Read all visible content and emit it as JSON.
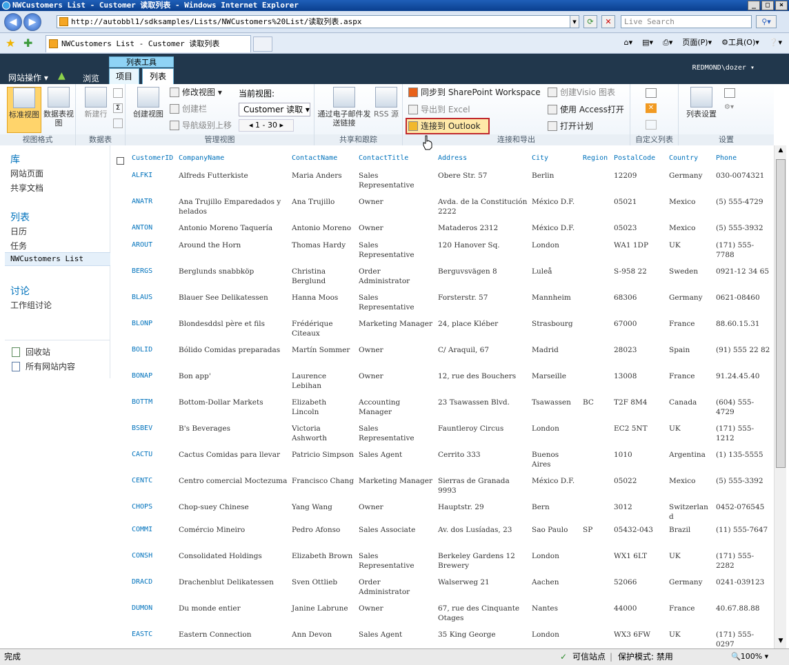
{
  "window": {
    "title": "NWCustomers List - Customer 读取列表 - Windows Internet Explorer"
  },
  "browser": {
    "url": "http://autobbl1/sdksamples/Lists/NWCustomers%20List/读取列表.aspx",
    "search_placeholder": "Live Search",
    "tab_title": "NWCustomers List - Customer 读取列表",
    "page_menu": "页面(P)",
    "tools_menu": "工具(O)"
  },
  "sp": {
    "site_actions": "网站操作",
    "browse": "浏览",
    "ctx_group": "列表工具",
    "tab_items": "项目",
    "tab_list": "列表",
    "user": "REDMOND\\dozer"
  },
  "ribbon": {
    "std_view": "标准视图",
    "datasheet_view": "数据表视图",
    "new_row": "新建行",
    "create_view": "创建视图",
    "modify_view": "修改视图",
    "create_column": "创建栏",
    "navigate_up": "导航级别上移",
    "current_view_label": "当前视图:",
    "current_view": "Customer 读取",
    "pager": "1 - 30",
    "email_link": "通过电子邮件发送链接",
    "rss": "RSS 源",
    "sync_workspace": "同步到 SharePoint Workspace",
    "export_excel": "导出到 Excel",
    "connect_outlook": "连接到 Outlook",
    "create_visio": "创建Visio 图表",
    "open_access": "使用 Access打开",
    "open_schedule": "打开计划",
    "list_settings": "列表设置",
    "groups": {
      "view_format": "视图格式",
      "datasheet": "数据表",
      "manage_views": "管理视图",
      "share_track": "共享和跟踪",
      "connect_export": "连接和导出",
      "custom_lists": "自定义列表",
      "settings": "设置"
    }
  },
  "nav": {
    "libraries": "库",
    "site_pages": "网站页面",
    "shared_docs": "共享文档",
    "lists": "列表",
    "calendar": "日历",
    "tasks": "任务",
    "nw_list": "NWCustomers List",
    "discussions": "讨论",
    "team_discussion": "工作组讨论",
    "recycle_bin": "回收站",
    "all_content": "所有网站内容"
  },
  "table": {
    "columns": [
      "CustomerID",
      "CompanyName",
      "ContactName",
      "ContactTitle",
      "Address",
      "City",
      "Region",
      "PostalCode",
      "Country",
      "Phone"
    ],
    "rows": [
      [
        "ALFKI",
        "Alfreds Futterkiste",
        "Maria Anders",
        "Sales Representative",
        "Obere Str. 57",
        "Berlin",
        "",
        "12209",
        "Germany",
        "030-0074321"
      ],
      [
        "ANATR",
        "Ana Trujillo Emparedados y helados",
        "Ana Trujillo",
        "Owner",
        "Avda. de la Constitución 2222",
        "México D.F.",
        "",
        "05021",
        "Mexico",
        "(5) 555-4729"
      ],
      [
        "ANTON",
        "Antonio Moreno Taquería",
        "Antonio Moreno",
        "Owner",
        "Mataderos 2312",
        "México D.F.",
        "",
        "05023",
        "Mexico",
        "(5) 555-3932"
      ],
      [
        "AROUT",
        "Around the Horn",
        "Thomas Hardy",
        "Sales Representative",
        "120 Hanover Sq.",
        "London",
        "",
        "WA1 1DP",
        "UK",
        "(171) 555-7788"
      ],
      [
        "BERGS",
        "Berglunds snabbköp",
        "Christina Berglund",
        "Order Administrator",
        "Berguvsvägen 8",
        "Luleå",
        "",
        "S-958 22",
        "Sweden",
        "0921-12 34 65"
      ],
      [
        "BLAUS",
        "Blauer See Delikatessen",
        "Hanna Moos",
        "Sales Representative",
        "Forsterstr. 57",
        "Mannheim",
        "",
        "68306",
        "Germany",
        "0621-08460"
      ],
      [
        "BLONP",
        "Blondesddsl père et fils",
        "Frédérique Citeaux",
        "Marketing Manager",
        "24, place Kléber",
        "Strasbourg",
        "",
        "67000",
        "France",
        "88.60.15.31"
      ],
      [
        "BOLID",
        "Bólido Comidas preparadas",
        "Martín Sommer",
        "Owner",
        "C/ Araquil, 67",
        "Madrid",
        "",
        "28023",
        "Spain",
        "(91) 555 22 82"
      ],
      [
        "BONAP",
        "Bon app'",
        "Laurence Lebihan",
        "Owner",
        "12, rue des Bouchers",
        "Marseille",
        "",
        "13008",
        "France",
        "91.24.45.40"
      ],
      [
        "BOTTM",
        "Bottom-Dollar Markets",
        "Elizabeth Lincoln",
        "Accounting Manager",
        "23 Tsawassen Blvd.",
        "Tsawassen",
        "BC",
        "T2F 8M4",
        "Canada",
        "(604) 555-4729"
      ],
      [
        "BSBEV",
        "B's Beverages",
        "Victoria Ashworth",
        "Sales Representative",
        "Fauntleroy Circus",
        "London",
        "",
        "EC2 5NT",
        "UK",
        "(171) 555-1212"
      ],
      [
        "CACTU",
        "Cactus Comidas para llevar",
        "Patricio Simpson",
        "Sales Agent",
        "Cerrito 333",
        "Buenos Aires",
        "",
        "1010",
        "Argentina",
        "(1) 135-5555"
      ],
      [
        "CENTC",
        "Centro comercial Moctezuma",
        "Francisco Chang",
        "Marketing Manager",
        "Sierras de Granada 9993",
        "México D.F.",
        "",
        "05022",
        "Mexico",
        "(5) 555-3392"
      ],
      [
        "CHOPS",
        "Chop-suey Chinese",
        "Yang Wang",
        "Owner",
        "Hauptstr. 29",
        "Bern",
        "",
        "3012",
        "Switzerland",
        "0452-076545"
      ],
      [
        "COMMI",
        "Comércio Mineiro",
        "Pedro Afonso",
        "Sales Associate",
        "Av. dos Lusíadas, 23",
        "Sao Paulo",
        "SP",
        "05432-043",
        "Brazil",
        "(11) 555-7647"
      ],
      [
        "CONSH",
        "Consolidated Holdings",
        "Elizabeth Brown",
        "Sales Representative",
        "Berkeley Gardens 12 Brewery",
        "London",
        "",
        "WX1 6LT",
        "UK",
        "(171) 555-2282"
      ],
      [
        "DRACD",
        "Drachenblut Delikatessen",
        "Sven Ottlieb",
        "Order Administrator",
        "Walserweg 21",
        "Aachen",
        "",
        "52066",
        "Germany",
        "0241-039123"
      ],
      [
        "DUMON",
        "Du monde entier",
        "Janine Labrune",
        "Owner",
        "67, rue des Cinquante Otages",
        "Nantes",
        "",
        "44000",
        "France",
        "40.67.88.88"
      ],
      [
        "EASTC",
        "Eastern Connection",
        "Ann Devon",
        "Sales Agent",
        "35 King George",
        "London",
        "",
        "WX3 6FW",
        "UK",
        "(171) 555-0297"
      ]
    ]
  },
  "status": {
    "done": "完成",
    "trusted": "可信站点",
    "protected": "保护模式: 禁用",
    "zoom": "100%"
  }
}
